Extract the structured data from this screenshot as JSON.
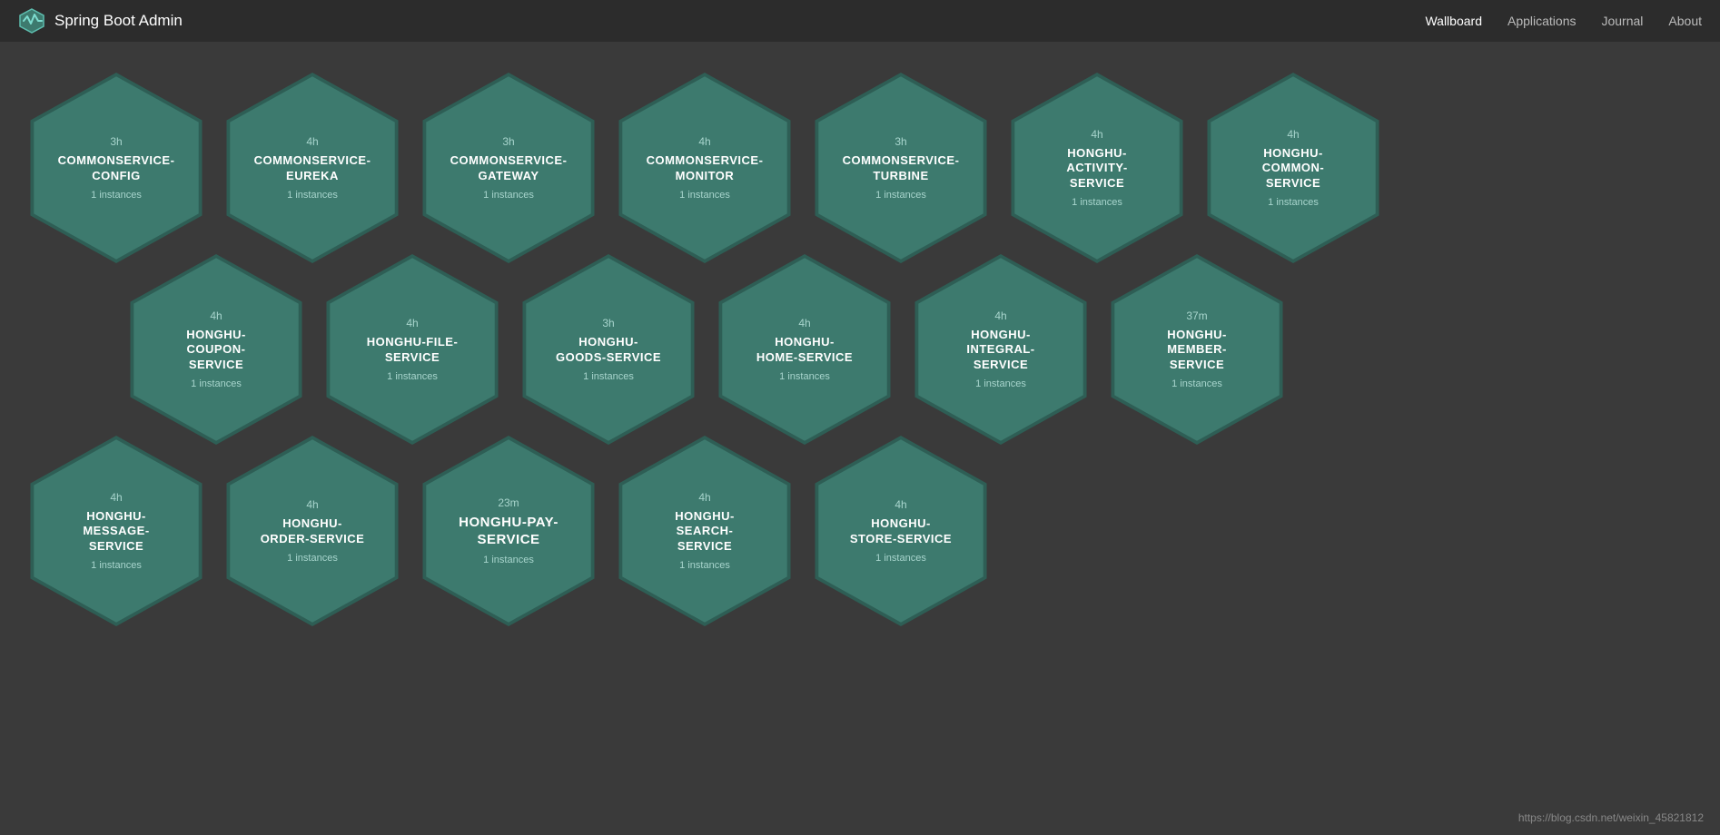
{
  "nav": {
    "brand": "Spring Boot Admin",
    "links": [
      {
        "label": "Wallboard",
        "active": true
      },
      {
        "label": "Applications",
        "active": false
      },
      {
        "label": "Journal",
        "active": false
      },
      {
        "label": "About",
        "active": false
      }
    ]
  },
  "footer": "https://blog.csdn.net/weixin_45821812",
  "rows": [
    {
      "offset": false,
      "items": [
        {
          "time": "3h",
          "name": "COMMONSERVICE-CONFIG",
          "instances": "1 instances"
        },
        {
          "time": "4h",
          "name": "COMMONSERVICE-EUREKA",
          "instances": "1 instances"
        },
        {
          "time": "3h",
          "name": "COMMONSERVICE-GATEWAY",
          "instances": "1 instances"
        },
        {
          "time": "4h",
          "name": "COMMONSERVICE-MONITOR",
          "instances": "1 instances"
        },
        {
          "time": "3h",
          "name": "COMMONSERVICE-TURBINE",
          "instances": "1 instances"
        },
        {
          "time": "4h",
          "name": "HONGHU-ACTIVITY-SERVICE",
          "instances": "1 instances"
        },
        {
          "time": "4h",
          "name": "HONGHU-COMMON-SERVICE",
          "instances": "1 instances"
        }
      ]
    },
    {
      "offset": true,
      "items": [
        {
          "time": "4h",
          "name": "HONGHU-COUPON-SERVICE",
          "instances": "1 instances"
        },
        {
          "time": "4h",
          "name": "HONGHU-FILE-SERVICE",
          "instances": "1 instances"
        },
        {
          "time": "3h",
          "name": "HONGHU-GOODS-SERVICE",
          "instances": "1 instances"
        },
        {
          "time": "4h",
          "name": "HONGHU-HOME-SERVICE",
          "instances": "1 instances"
        },
        {
          "time": "4h",
          "name": "HONGHU-INTEGRAL-SERVICE",
          "instances": "1 instances"
        },
        {
          "time": "37m",
          "name": "HONGHU-MEMBER-SERVICE",
          "instances": "1 instances"
        }
      ]
    },
    {
      "offset": false,
      "items": [
        {
          "time": "4h",
          "name": "HONGHU-MESSAGE-SERVICE",
          "instances": "1 instances"
        },
        {
          "time": "4h",
          "name": "HONGHU-ORDER-SERVICE",
          "instances": "1 instances"
        },
        {
          "time": "23m",
          "name": "HONGHU-PAY-SERVICE",
          "instances": "1 instances"
        },
        {
          "time": "4h",
          "name": "HONGHU-SEARCH-SERVICE",
          "instances": "1 instances"
        },
        {
          "time": "4h",
          "name": "HONGHU-STORE-SERVICE",
          "instances": "1 instances"
        }
      ]
    }
  ]
}
